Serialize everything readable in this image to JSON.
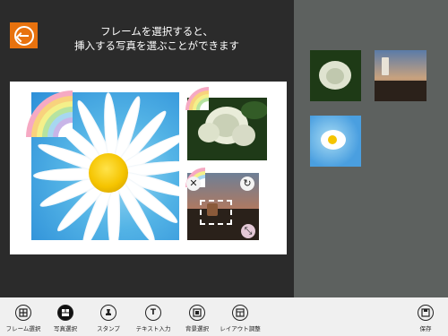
{
  "instruction": {
    "line1": "フレームを選択すると、",
    "line2": "挿入する写真を選ぶことができます"
  },
  "appbar": {
    "frame_select": "フレーム選択",
    "photo_select": "写真選択",
    "stamp": "スタンプ",
    "text_input": "テキスト入力",
    "background_select": "背景選択",
    "layout_adjust": "レイアウト調整",
    "save": "保存",
    "text_icon_glyph": "T"
  },
  "icons": {
    "back": "back-arrow-icon",
    "close": "close-icon",
    "rotate": "rotate-icon",
    "resize": "resize-icon"
  },
  "glyphs": {
    "close": "✕",
    "rotate": "↻",
    "resize": "⤡"
  },
  "colors": {
    "accent": "#e8720e",
    "panel": "#2b2b2b",
    "side_panel": "#5d615f",
    "appbar": "#f0f0f0"
  }
}
